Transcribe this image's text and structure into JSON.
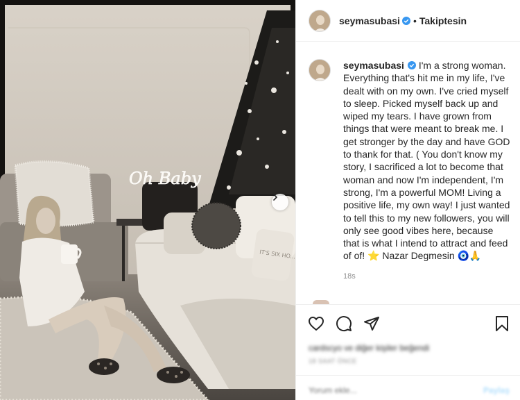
{
  "post": {
    "username": "seymasubasi",
    "separator": "•",
    "follow_label": "Takiptesin",
    "caption": "I'm a strong woman. Everything that's hit me in my life, I've dealt with on my own. I've cried myself to sleep. Picked myself back up and wiped my tears. I have grown from things that were meant to break me. I get stronger by the day and have GOD to thank for that. ( You don't know my story, I sacrificed a lot to become that woman and now I'm independent, I'm strong, I'm a powerful MOM! Living a positive life, my own way! I just wanted to tell this to my new followers, you will only see good vibes here, because that is what I intend to attract and feed of of! ⭐ Nazar Degmesin 🧿🙏",
    "time_ago": "18s"
  },
  "photo": {
    "neon_sign_text": "Oh Baby",
    "pillow_text": "IT'S SIX HO..."
  },
  "engagement": {
    "likes_text": "cardscyo ve diğer kişiler beğendi",
    "date_text": "18 SAAT ÖNCE"
  },
  "comment": {
    "placeholder": "Yorum ekle...",
    "share_label": "Paylaş"
  },
  "colors": {
    "verified": "#3897f0",
    "share_disabled": "#b2dffc",
    "muted_text": "#8e8e8e",
    "border": "#efefef"
  },
  "icons": [
    "verified-badge-icon",
    "chevron-right-icon",
    "heart-icon",
    "comment-icon",
    "share-icon",
    "bookmark-icon"
  ]
}
